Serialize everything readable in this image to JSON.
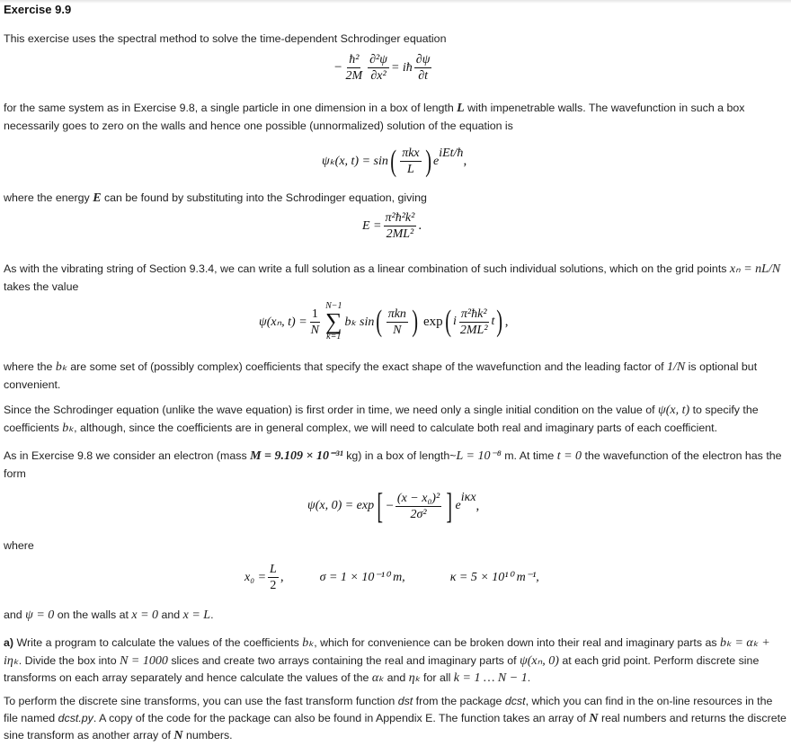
{
  "title": "Exercise 9.9",
  "paragraphs": {
    "p1": "This exercise uses the spectral method to solve the time-dependent Schrodinger equation",
    "p2_a": "for the same system as in Exercise 9.8, a single particle in one dimension in a box of length ",
    "p2_L": "L",
    "p2_b": " with impenetrable walls. The wavefunction in such a box necessarily goes to zero on the walls and hence one possible (unnormalized) solution of the equation is",
    "p3_a": "where the energy ",
    "p3_E": "E",
    "p3_b": " can be found by substituting into the Schrodinger equation, giving",
    "p4_a": "As with the vibrating string of Section 9.3.4, we can write a full solution as a linear combination of such individual solutions, which on the grid points ",
    "p4_math": "xₙ = nL/N",
    "p4_b": " takes the value",
    "p5_a": "where the ",
    "p5_bk": "bₖ",
    "p5_b": " are some set of (possibly complex) coefficients that specify the exact shape of the wavefunction and the leading factor of ",
    "p5_1N": "1/N",
    "p5_c": " is optional but convenient.",
    "p6_a": "Since the Schrodinger equation (unlike the wave equation) is first order in time, we need only a single initial condition on the value of ",
    "p6_psi": "ψ(x, t)",
    "p6_b": " to specify the coefficients ",
    "p6_bk": "bₖ",
    "p6_c": ", although, since the coefficients are in general complex, we will need to calculate both real and imaginary parts of each coefficient.",
    "p7_a": "As in Exercise 9.8 we consider an electron (mass ",
    "p7_M": "M = 9.109 × 10⁻³¹",
    "p7_b": " kg) in a box of length~",
    "p7_L": "L = 10⁻⁸",
    "p7_c": " m. At time ",
    "p7_t": "t = 0",
    "p7_d": " the wavefunction of the electron has the form",
    "p8": "where",
    "p9_a": "and ",
    "p9_psi": "ψ = 0",
    "p9_b": " on the walls at ",
    "p9_x0": "x = 0",
    "p9_c": " and ",
    "p9_xL": "x = L",
    "p9_d": ".",
    "p10_label": "a)",
    "p10_a": " Write a program to calculate the values of the coefficients ",
    "p10_bk": "bₖ",
    "p10_b": ", which for convenience can be broken down into their real and imaginary parts as ",
    "p10_eq": "bₖ = αₖ + iηₖ",
    "p10_c": ". Divide the box into ",
    "p10_N": "N = 1000",
    "p10_d": " slices and create two arrays containing the real and imaginary parts of ",
    "p10_psi": "ψ(xₙ, 0)",
    "p10_e": " at each grid point. Perform discrete sine transforms on each array separately and hence calculate the values of the ",
    "p10_ak": "αₖ",
    "p10_f": " and ",
    "p10_nk": "ηₖ",
    "p10_g": " for all ",
    "p10_k": "k = 1 … N − 1",
    "p10_h": ".",
    "p11_a": "To perform the discrete sine transforms, you can use the fast transform function ",
    "p11_dst": "dst",
    "p11_b": " from the package ",
    "p11_dcst": "dcst",
    "p11_c": ", which you can find in the on-line resources in the file named ",
    "p11_file": "dcst.py",
    "p11_d": ". A copy of the code for the package can also be found in Appendix E. The function takes an array of ",
    "p11_N1": "N",
    "p11_e": " real numbers and returns the discrete sine transform as another array of ",
    "p11_N2": "N",
    "p11_f": " numbers."
  },
  "equations": {
    "schrodinger": {
      "minus": "−",
      "hbar2": "ħ²",
      "twoM": "2M",
      "d2psi": "∂²ψ",
      "dx2": "∂x²",
      "eq": " = iħ",
      "dpsi": "∂ψ",
      "dt": "∂t"
    },
    "psik": {
      "lhs": "ψₖ(x, t) = sin",
      "num": "πkx",
      "den": "L",
      "exp": "e",
      "sup": "iEt/ħ",
      "tail": ","
    },
    "energy": {
      "lhs": "E = ",
      "num": "π²ħ²k²",
      "den": "2ML²",
      "tail": "."
    },
    "series": {
      "lhs": "ψ(xₙ, t) = ",
      "one": "1",
      "N": "N",
      "upper": "N−1",
      "sigma": "∑",
      "lower": "k=1",
      "bk": "bₖ sin",
      "num": "πkn",
      "den": "N",
      "exp": "exp",
      "i": "i",
      "num2": "π²ħk²",
      "den2": "2ML²",
      "t": "t",
      "tail": ","
    },
    "initial": {
      "lhs": "ψ(x, 0) = exp",
      "minus": "−",
      "num": "(x − x₀)²",
      "den": "2σ²",
      "e": "e",
      "sup": "iκx",
      "tail": ","
    },
    "params": {
      "x0": "x₀ = ",
      "x0num": "L",
      "x0den": "2",
      "x0tail": ",",
      "sigma": "σ = 1 × 10⁻¹⁰ m,",
      "kappa": "κ = 5 × 10¹⁰ m⁻¹,"
    }
  }
}
